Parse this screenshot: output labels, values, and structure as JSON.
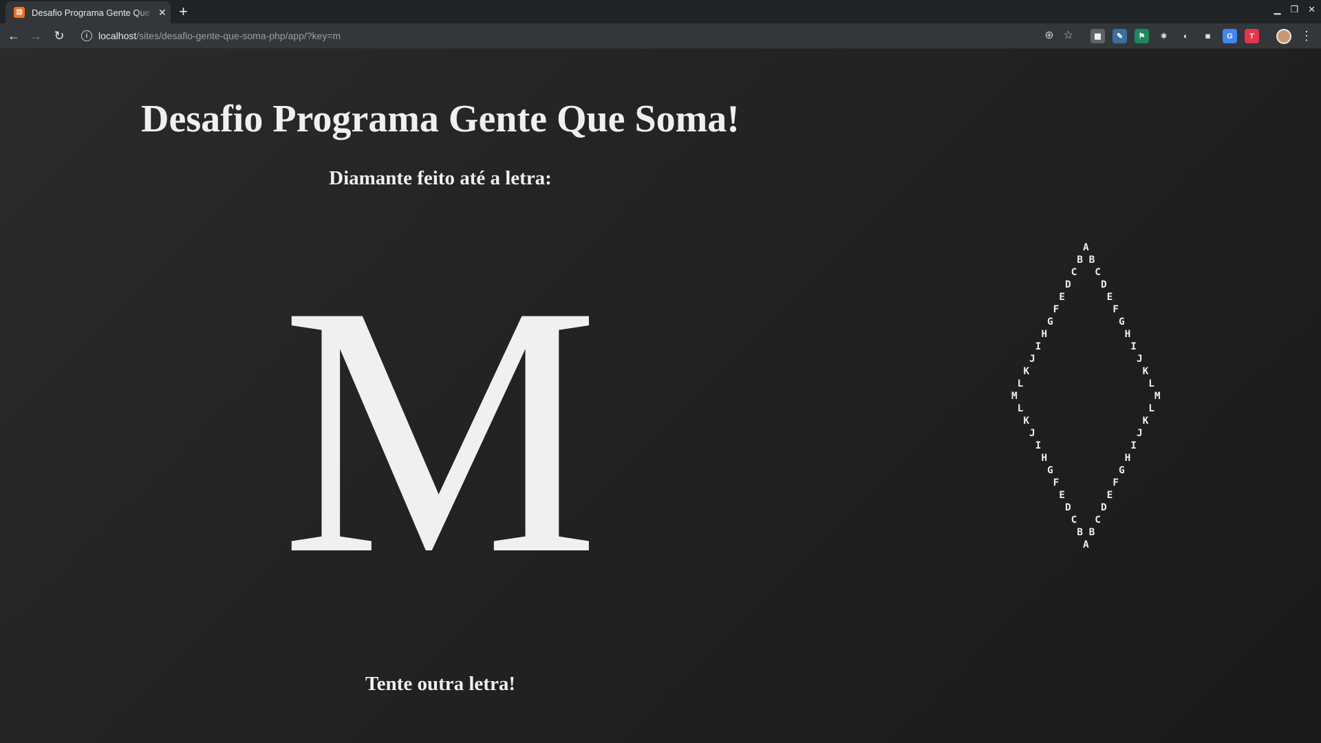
{
  "browser": {
    "tab_title": "Desafio Programa Gente Que Soma!",
    "tab_favicon_text": "⚄",
    "url_host": "localhost",
    "url_path": "/sites/desafio-gente-que-soma-php/app/?key=m",
    "extensions": [
      {
        "name": "extension-1",
        "glyph": "▦",
        "color": "#5f6368"
      },
      {
        "name": "extension-2",
        "glyph": "✎",
        "color": "#3c6e9f"
      },
      {
        "name": "extension-3",
        "glyph": "⚑",
        "color": "#1b8a5a"
      },
      {
        "name": "extension-4",
        "glyph": "⚛",
        "color": "#33373a"
      },
      {
        "name": "extension-5",
        "glyph": "◐",
        "color": "#33373a"
      },
      {
        "name": "extension-6",
        "glyph": "◙",
        "color": "#33373a"
      },
      {
        "name": "extension-7",
        "glyph": "G",
        "color": "#4285f4"
      },
      {
        "name": "extension-8",
        "glyph": "T",
        "color": "#e8334a"
      }
    ]
  },
  "page": {
    "title": "Desafio Programa Gente Que Soma!",
    "subtitle": "Diamante feito até a letra:",
    "letter": "M",
    "retry": "Tente outra letra!",
    "diamond_rows": [
      "            A",
      "           B B",
      "          C   C",
      "         D     D",
      "        E       E",
      "       F         F",
      "      G           G",
      "     H             H",
      "    I               I",
      "   J                 J",
      "  K                   K",
      " L                     L",
      "M                       M",
      " L                     L",
      "  K                   K",
      "   J                 J",
      "    I               I",
      "     H             H",
      "      G           G",
      "       F         F",
      "        E       E",
      "         D     D",
      "          C   C",
      "           B B",
      "            A"
    ]
  }
}
